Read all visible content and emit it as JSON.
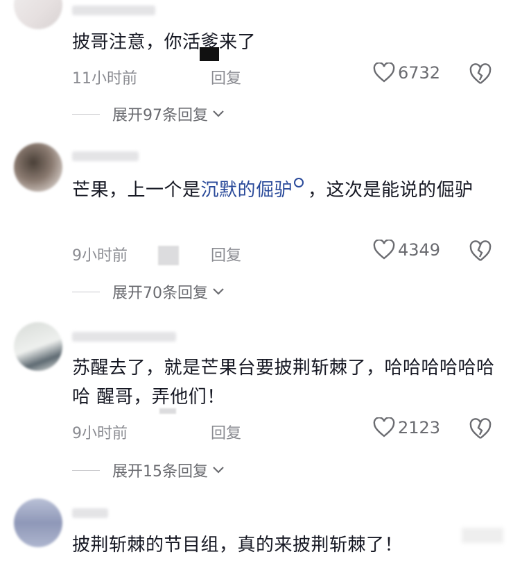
{
  "comments": [
    {
      "text_parts": [
        "披哥注意，你活爹来了"
      ],
      "time": "11小时前",
      "reply": "回复",
      "likes": "6732",
      "expand": "展开97条回复"
    },
    {
      "text_before": "芒果，上一个是",
      "link": "沉默的倔驴",
      "text_after": "，这次是能说的倔驴",
      "time": "9小时前",
      "reply": "回复",
      "likes": "4349",
      "expand": "展开70条回复"
    },
    {
      "text": "苏醒去了，就是芒果台要披荆斩棘了，哈哈哈哈哈哈哈  醒哥，弄他们！",
      "time": "9小时前",
      "reply": "回复",
      "likes": "2123",
      "expand": "展开15条回复"
    },
    {
      "text": "披荆斩棘的节目组，真的来披荆斩棘了！"
    }
  ],
  "icons": {
    "like": "heart-outline-icon",
    "dislike": "broken-heart-icon",
    "expand": "chevron-down-icon",
    "search": "search-icon"
  },
  "colors": {
    "text": "#161823",
    "meta": "#8a8b91",
    "link": "#2a4a9a"
  }
}
